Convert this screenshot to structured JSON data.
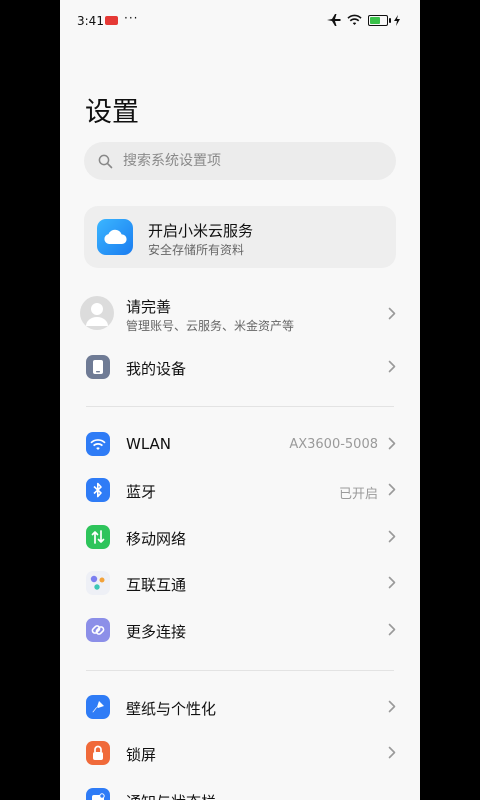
{
  "status_bar": {
    "time": "3:41",
    "dots": "···",
    "icons": [
      "notification-badge-icon",
      "airplane-icon",
      "wifi-icon",
      "battery-icon",
      "charging-icon"
    ],
    "battery_color": "#3ac14a"
  },
  "header": {
    "title": "设置"
  },
  "search": {
    "placeholder": "搜索系统设置项"
  },
  "cloud_card": {
    "title": "开启小米云服务",
    "subtitle": "安全存储所有资料",
    "icon": "cloud-icon",
    "accent": "#1a7cf0"
  },
  "account": {
    "title": "请完善",
    "subtitle": "管理账号、云服务、米金资产等"
  },
  "device": {
    "label": "我的设备"
  },
  "connectivity": {
    "wlan": {
      "label": "WLAN",
      "value": "AX3600-5008",
      "color": "#2f7cf6"
    },
    "bluetooth": {
      "label": "蓝牙",
      "value": "已开启",
      "color": "#2f7cf6"
    },
    "mobile": {
      "label": "移动网络",
      "color": "#2ec45b"
    },
    "interconnect": {
      "label": "互联互通"
    },
    "more": {
      "label": "更多连接",
      "color": "#8c8fe8"
    }
  },
  "personalization": {
    "wallpaper": {
      "label": "壁纸与个性化",
      "color": "#2f7cf6"
    },
    "lockscreen": {
      "label": "锁屏",
      "color": "#f06a3a"
    },
    "notifications": {
      "label": "通知与状态栏"
    }
  }
}
